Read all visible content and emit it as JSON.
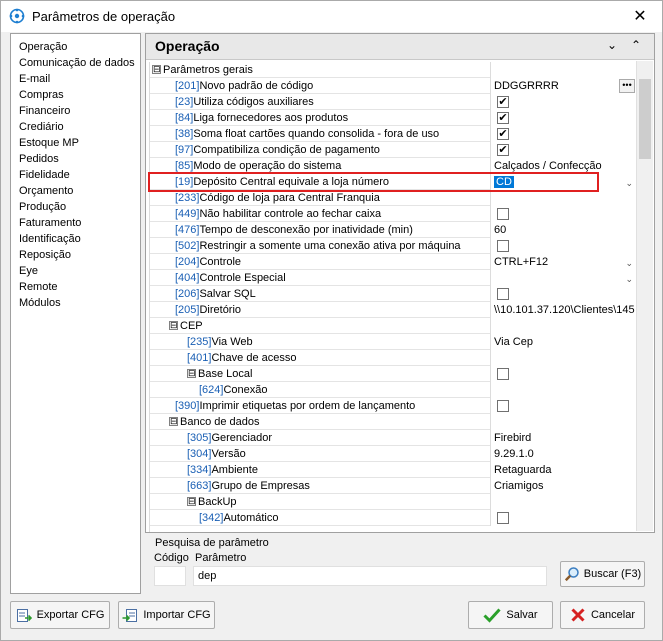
{
  "window": {
    "title": "Parâmetros de operação",
    "close_glyph": "✕"
  },
  "sidebar": {
    "items": [
      "Operação",
      "Comunicação de dados",
      "E-mail",
      "Compras",
      "Financeiro",
      "Crediário",
      "Estoque MP",
      "Pedidos",
      "Fidelidade",
      "Orçamento",
      "Produção",
      "Faturamento",
      "Identificação",
      "Reposição",
      "Eye",
      "Remote",
      "Módulos"
    ]
  },
  "main": {
    "title": "Operação",
    "collapse_glyph": "⌄",
    "expand_glyph": "⌃"
  },
  "rows": [
    {
      "level": 0,
      "toggle": "⊟",
      "code": "",
      "label": "Parâmetros gerais",
      "value": "",
      "type": "group"
    },
    {
      "level": 1,
      "code": "[201]",
      "label": "Novo padrão de código",
      "value": "DDGGRRRR",
      "type": "dots"
    },
    {
      "level": 1,
      "code": "[23]",
      "label": "Utiliza códigos auxiliares",
      "value": "",
      "type": "check",
      "checked": true
    },
    {
      "level": 1,
      "code": "[84]",
      "label": "Liga fornecedores aos produtos",
      "value": "",
      "type": "check",
      "checked": true
    },
    {
      "level": 1,
      "code": "[38]",
      "label": "Soma float cartões quando consolida - fora de uso",
      "value": "",
      "type": "check",
      "checked": true
    },
    {
      "level": 1,
      "code": "[97]",
      "label": "Compatibiliza condição de pagamento",
      "value": "",
      "type": "check",
      "checked": true
    },
    {
      "level": 1,
      "code": "[85]",
      "label": "Modo de operação do sistema",
      "value": "Calçados / Confecção",
      "type": "text"
    },
    {
      "level": 1,
      "code": "[19]",
      "label": "Depósito Central equivale a loja número",
      "value": "CD",
      "type": "select",
      "selected": true
    },
    {
      "level": 1,
      "code": "[233]",
      "label": "Código de loja para Central Franquia",
      "value": "",
      "type": "text"
    },
    {
      "level": 1,
      "code": "[449]",
      "label": "Não habilitar controle ao fechar caixa",
      "value": "",
      "type": "check",
      "checked": false
    },
    {
      "level": 1,
      "code": "[476]",
      "label": "Tempo de desconexão por inatividade (min)",
      "value": "60",
      "type": "text"
    },
    {
      "level": 1,
      "code": "[502]",
      "label": "Restringir a somente uma conexão ativa por máquina",
      "value": "",
      "type": "check",
      "checked": false
    },
    {
      "level": 1,
      "code": "[204]",
      "label": "Controle",
      "value": "CTRL+F12",
      "type": "select"
    },
    {
      "level": 1,
      "code": "[404]",
      "label": "Controle Especial",
      "value": "",
      "type": "select"
    },
    {
      "level": 1,
      "code": "[206]",
      "label": "Salvar SQL",
      "value": "",
      "type": "check",
      "checked": false
    },
    {
      "level": 1,
      "code": "[205]",
      "label": "Diretório",
      "value": "\\\\10.101.37.120\\Clientes\\145",
      "type": "text"
    },
    {
      "level": 1,
      "toggle": "⊟",
      "code": "",
      "label": "CEP",
      "value": "",
      "type": "group"
    },
    {
      "level": 3,
      "code": "[235]",
      "label": "Via Web",
      "value": "Via Cep",
      "type": "text"
    },
    {
      "level": 3,
      "code": "[401]",
      "label": "Chave de acesso",
      "value": "",
      "type": "text"
    },
    {
      "level": 2,
      "toggle": "⊟",
      "code": "",
      "label": "Base Local",
      "value": "",
      "type": "check",
      "checked": false
    },
    {
      "level": 4,
      "code": "[624]",
      "label": "Conexão",
      "value": "",
      "type": "text"
    },
    {
      "level": 1,
      "code": "[390]",
      "label": "Imprimir etiquetas por ordem de lançamento",
      "value": "",
      "type": "check",
      "checked": false
    },
    {
      "level": 1,
      "toggle": "⊟",
      "code": "",
      "label": "Banco de dados",
      "value": "",
      "type": "group"
    },
    {
      "level": 3,
      "code": "[305]",
      "label": "Gerenciador",
      "value": "Firebird",
      "type": "text"
    },
    {
      "level": 3,
      "code": "[304]",
      "label": "Versão",
      "value": " 9.29.1.0",
      "type": "text"
    },
    {
      "level": 3,
      "code": "[334]",
      "label": "Ambiente",
      "value": "Retaguarda",
      "type": "text"
    },
    {
      "level": 3,
      "code": "[663]",
      "label": "Grupo de Empresas",
      "value": "Criamigos",
      "type": "text"
    },
    {
      "level": 2,
      "toggle": "⊟",
      "code": "",
      "label": "BackUp",
      "value": "",
      "type": "group"
    },
    {
      "level": 4,
      "code": "[342]",
      "label": "Automático",
      "value": "",
      "type": "check",
      "checked": false
    }
  ],
  "search": {
    "legend": "Pesquisa de parâmetro",
    "code_label": "Código",
    "param_label": "Parâmetro",
    "code_value": "",
    "param_value": "dep",
    "button": "Buscar (F3)"
  },
  "buttons": {
    "export": "Exportar CFG",
    "import": "Importar CFG",
    "save": "Salvar",
    "cancel": "Cancelar"
  }
}
